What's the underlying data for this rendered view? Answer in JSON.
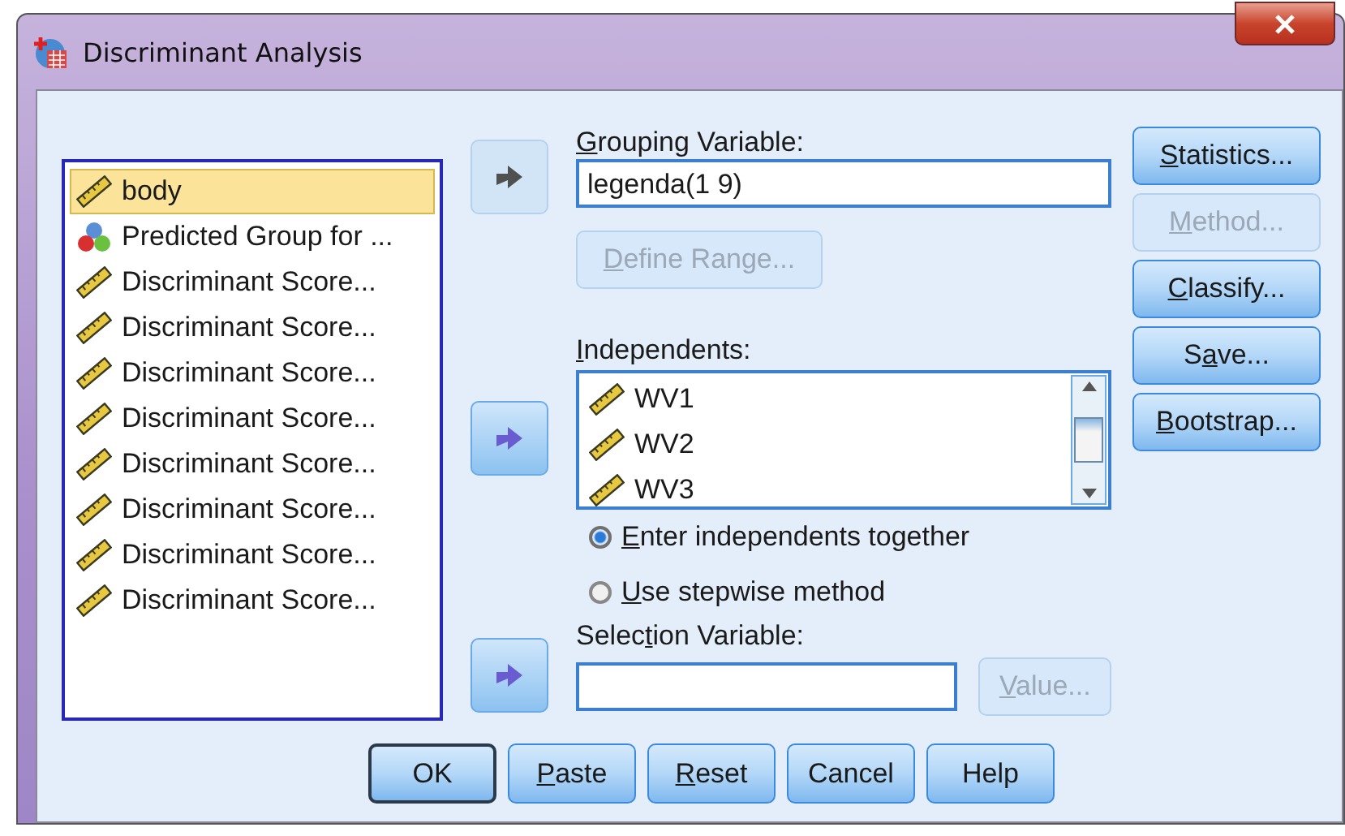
{
  "window": {
    "title": "Discriminant Analysis"
  },
  "variables": [
    {
      "name": "body",
      "kind": "scale",
      "selected": true
    },
    {
      "name": "Predicted Group for ...",
      "kind": "nominal",
      "selected": false
    },
    {
      "name": "Discriminant Score...",
      "kind": "scale",
      "selected": false
    },
    {
      "name": "Discriminant Score...",
      "kind": "scale",
      "selected": false
    },
    {
      "name": "Discriminant Score...",
      "kind": "scale",
      "selected": false
    },
    {
      "name": "Discriminant Score...",
      "kind": "scale",
      "selected": false
    },
    {
      "name": "Discriminant Score...",
      "kind": "scale",
      "selected": false
    },
    {
      "name": "Discriminant Score...",
      "kind": "scale",
      "selected": false
    },
    {
      "name": "Discriminant Score...",
      "kind": "scale",
      "selected": false
    },
    {
      "name": "Discriminant Score...",
      "kind": "scale",
      "selected": false
    }
  ],
  "grouping_variable": {
    "arrow_disabled": true,
    "label": [
      {
        "text": "G",
        "mnemonic": true
      },
      {
        "text": "rouping Variable:",
        "mnemonic": false
      }
    ],
    "value": "legenda(1 9)"
  },
  "define_range": {
    "disabled": true,
    "label": [
      {
        "text": "D",
        "mnemonic": true
      },
      {
        "text": "efine Range...",
        "mnemonic": false
      }
    ]
  },
  "independents": {
    "arrow_disabled": false,
    "label": [
      {
        "text": "I",
        "mnemonic": true
      },
      {
        "text": "ndependents:",
        "mnemonic": false
      }
    ],
    "items": [
      {
        "name": "WV1",
        "kind": "scale"
      },
      {
        "name": "WV2",
        "kind": "scale"
      },
      {
        "name": "WV3",
        "kind": "scale"
      }
    ]
  },
  "method_options": [
    {
      "selected": true,
      "label": [
        {
          "text": "E",
          "mnemonic": true
        },
        {
          "text": "nter independents together",
          "mnemonic": false
        }
      ]
    },
    {
      "selected": false,
      "label": [
        {
          "text": "U",
          "mnemonic": true
        },
        {
          "text": "se stepwise method",
          "mnemonic": false
        }
      ]
    }
  ],
  "selection_variable": {
    "arrow_disabled": false,
    "label": [
      {
        "text": "Selec",
        "mnemonic": false
      },
      {
        "text": "t",
        "mnemonic": true
      },
      {
        "text": "ion Variable:",
        "mnemonic": false
      }
    ],
    "value_button": {
      "disabled": true,
      "label": [
        {
          "text": "V",
          "mnemonic": true
        },
        {
          "text": "alue...",
          "mnemonic": false
        }
      ]
    }
  },
  "side_buttons": [
    {
      "disabled": false,
      "label": [
        {
          "text": "S",
          "mnemonic": true
        },
        {
          "text": "tatistics...",
          "mnemonic": false
        }
      ]
    },
    {
      "disabled": true,
      "label": [
        {
          "text": "M",
          "mnemonic": true
        },
        {
          "text": "ethod...",
          "mnemonic": false
        }
      ]
    },
    {
      "disabled": false,
      "label": [
        {
          "text": "C",
          "mnemonic": true
        },
        {
          "text": "lassify...",
          "mnemonic": false
        }
      ]
    },
    {
      "disabled": false,
      "label": [
        {
          "text": "S",
          "mnemonic": false
        },
        {
          "text": "a",
          "mnemonic": true
        },
        {
          "text": "ve...",
          "mnemonic": false
        }
      ]
    },
    {
      "disabled": false,
      "label": [
        {
          "text": "B",
          "mnemonic": true
        },
        {
          "text": "ootstrap...",
          "mnemonic": false
        }
      ]
    }
  ],
  "bottom_buttons": [
    {
      "default": true,
      "label": [
        {
          "text": "OK",
          "mnemonic": false
        }
      ]
    },
    {
      "default": false,
      "label": [
        {
          "text": "P",
          "mnemonic": true
        },
        {
          "text": "aste",
          "mnemonic": false
        }
      ]
    },
    {
      "default": false,
      "label": [
        {
          "text": "R",
          "mnemonic": true
        },
        {
          "text": "eset",
          "mnemonic": false
        }
      ]
    },
    {
      "default": false,
      "label": [
        {
          "text": "Cancel",
          "mnemonic": false
        }
      ]
    },
    {
      "default": false,
      "label": [
        {
          "text": "Help",
          "mnemonic": false
        }
      ]
    }
  ]
}
